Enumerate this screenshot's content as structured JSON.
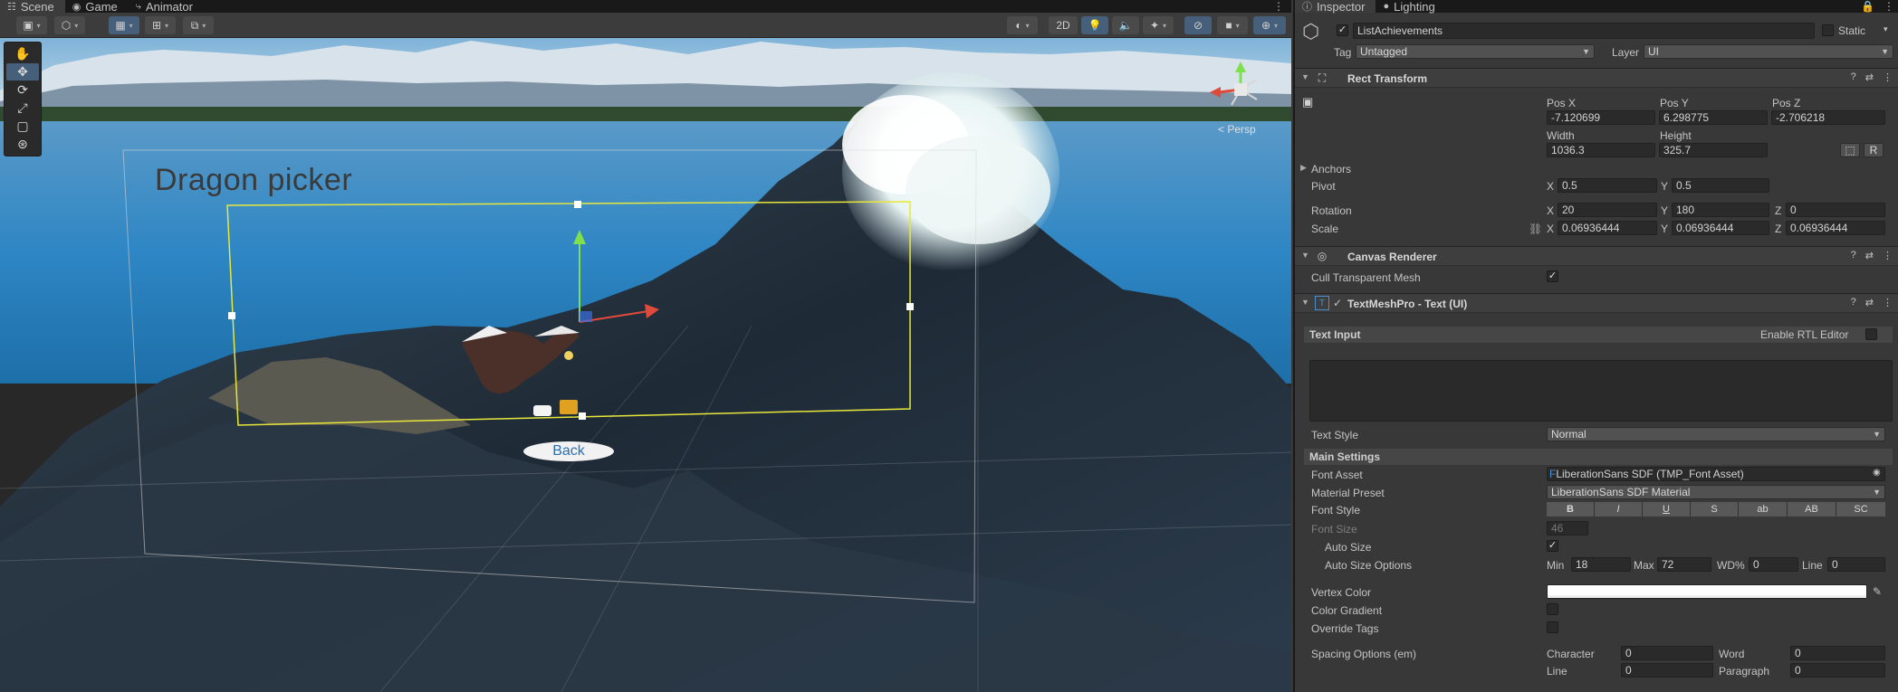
{
  "scene_tabs": [
    {
      "label": "Scene",
      "icon": "grid-icon"
    },
    {
      "label": "Game",
      "icon": "gamepad-icon"
    },
    {
      "label": "Animator",
      "icon": "animator-icon"
    }
  ],
  "scene_toolbar": {
    "mode_2d": "2D"
  },
  "scene_view": {
    "persp_label": "< Persp",
    "ui_title_text": "Dragon picker",
    "ui_back_button": "Back"
  },
  "inspector_tabs": [
    {
      "label": "Inspector",
      "icon": "info-icon"
    },
    {
      "label": "Lighting",
      "icon": "bulb-icon"
    }
  ],
  "object": {
    "name": "ListAchievements",
    "active": true,
    "static_label": "Static",
    "tag_label": "Tag",
    "tag_value": "Untagged",
    "layer_label": "Layer",
    "layer_value": "UI"
  },
  "rect_transform": {
    "title": "Rect Transform",
    "pos_x_label": "Pos X",
    "pos_x": "-7.120699",
    "pos_y_label": "Pos Y",
    "pos_y": "6.298775",
    "pos_z_label": "Pos Z",
    "pos_z": "-2.706218",
    "width_label": "Width",
    "width": "1036.3",
    "height_label": "Height",
    "height": "325.7",
    "anchors_label": "Anchors",
    "pivot_label": "Pivot",
    "pivot_x": "0.5",
    "pivot_y": "0.5",
    "rotation_label": "Rotation",
    "rot_x": "20",
    "rot_y": "180",
    "rot_z": "0",
    "scale_label": "Scale",
    "scale_x": "0.06936444",
    "scale_y": "0.06936444",
    "scale_z": "0.06936444",
    "raw_btn": "R"
  },
  "canvas_renderer": {
    "title": "Canvas Renderer",
    "cull_label": "Cull Transparent Mesh",
    "cull": true
  },
  "tmp": {
    "title": "TextMeshPro - Text (UI)",
    "text_input_label": "Text Input",
    "rtl_label": "Enable RTL Editor",
    "text_value": "",
    "text_style_label": "Text Style",
    "text_style": "Normal",
    "main_settings_label": "Main Settings",
    "font_asset_label": "Font Asset",
    "font_asset": "LiberationSans SDF (TMP_Font Asset)",
    "material_preset_label": "Material Preset",
    "material_preset": "LiberationSans SDF Material",
    "font_style_label": "Font Style",
    "font_style_buttons": [
      "B",
      "I",
      "U",
      "S",
      "ab",
      "AB",
      "SC"
    ],
    "font_size_label": "Font Size",
    "font_size": "46",
    "auto_size_label": "Auto Size",
    "auto_size": true,
    "auto_size_options_label": "Auto Size Options",
    "min_label": "Min",
    "min": "18",
    "max_label": "Max",
    "max": "72",
    "wd_label": "WD%",
    "wd": "0",
    "line_label": "Line",
    "line": "0",
    "vertex_color_label": "Vertex Color",
    "color_gradient_label": "Color Gradient",
    "override_tags_label": "Override Tags",
    "spacing_label": "Spacing Options (em)",
    "character_label": "Character",
    "character": "0",
    "word_label": "Word",
    "word": "0",
    "sp_line_label": "Line",
    "sp_line": "0",
    "paragraph_label": "Paragraph",
    "paragraph": "0"
  },
  "colors": {
    "accent": "#46607c",
    "selection_rect": "#e8e83a",
    "vertex_color": "#ffffff"
  }
}
